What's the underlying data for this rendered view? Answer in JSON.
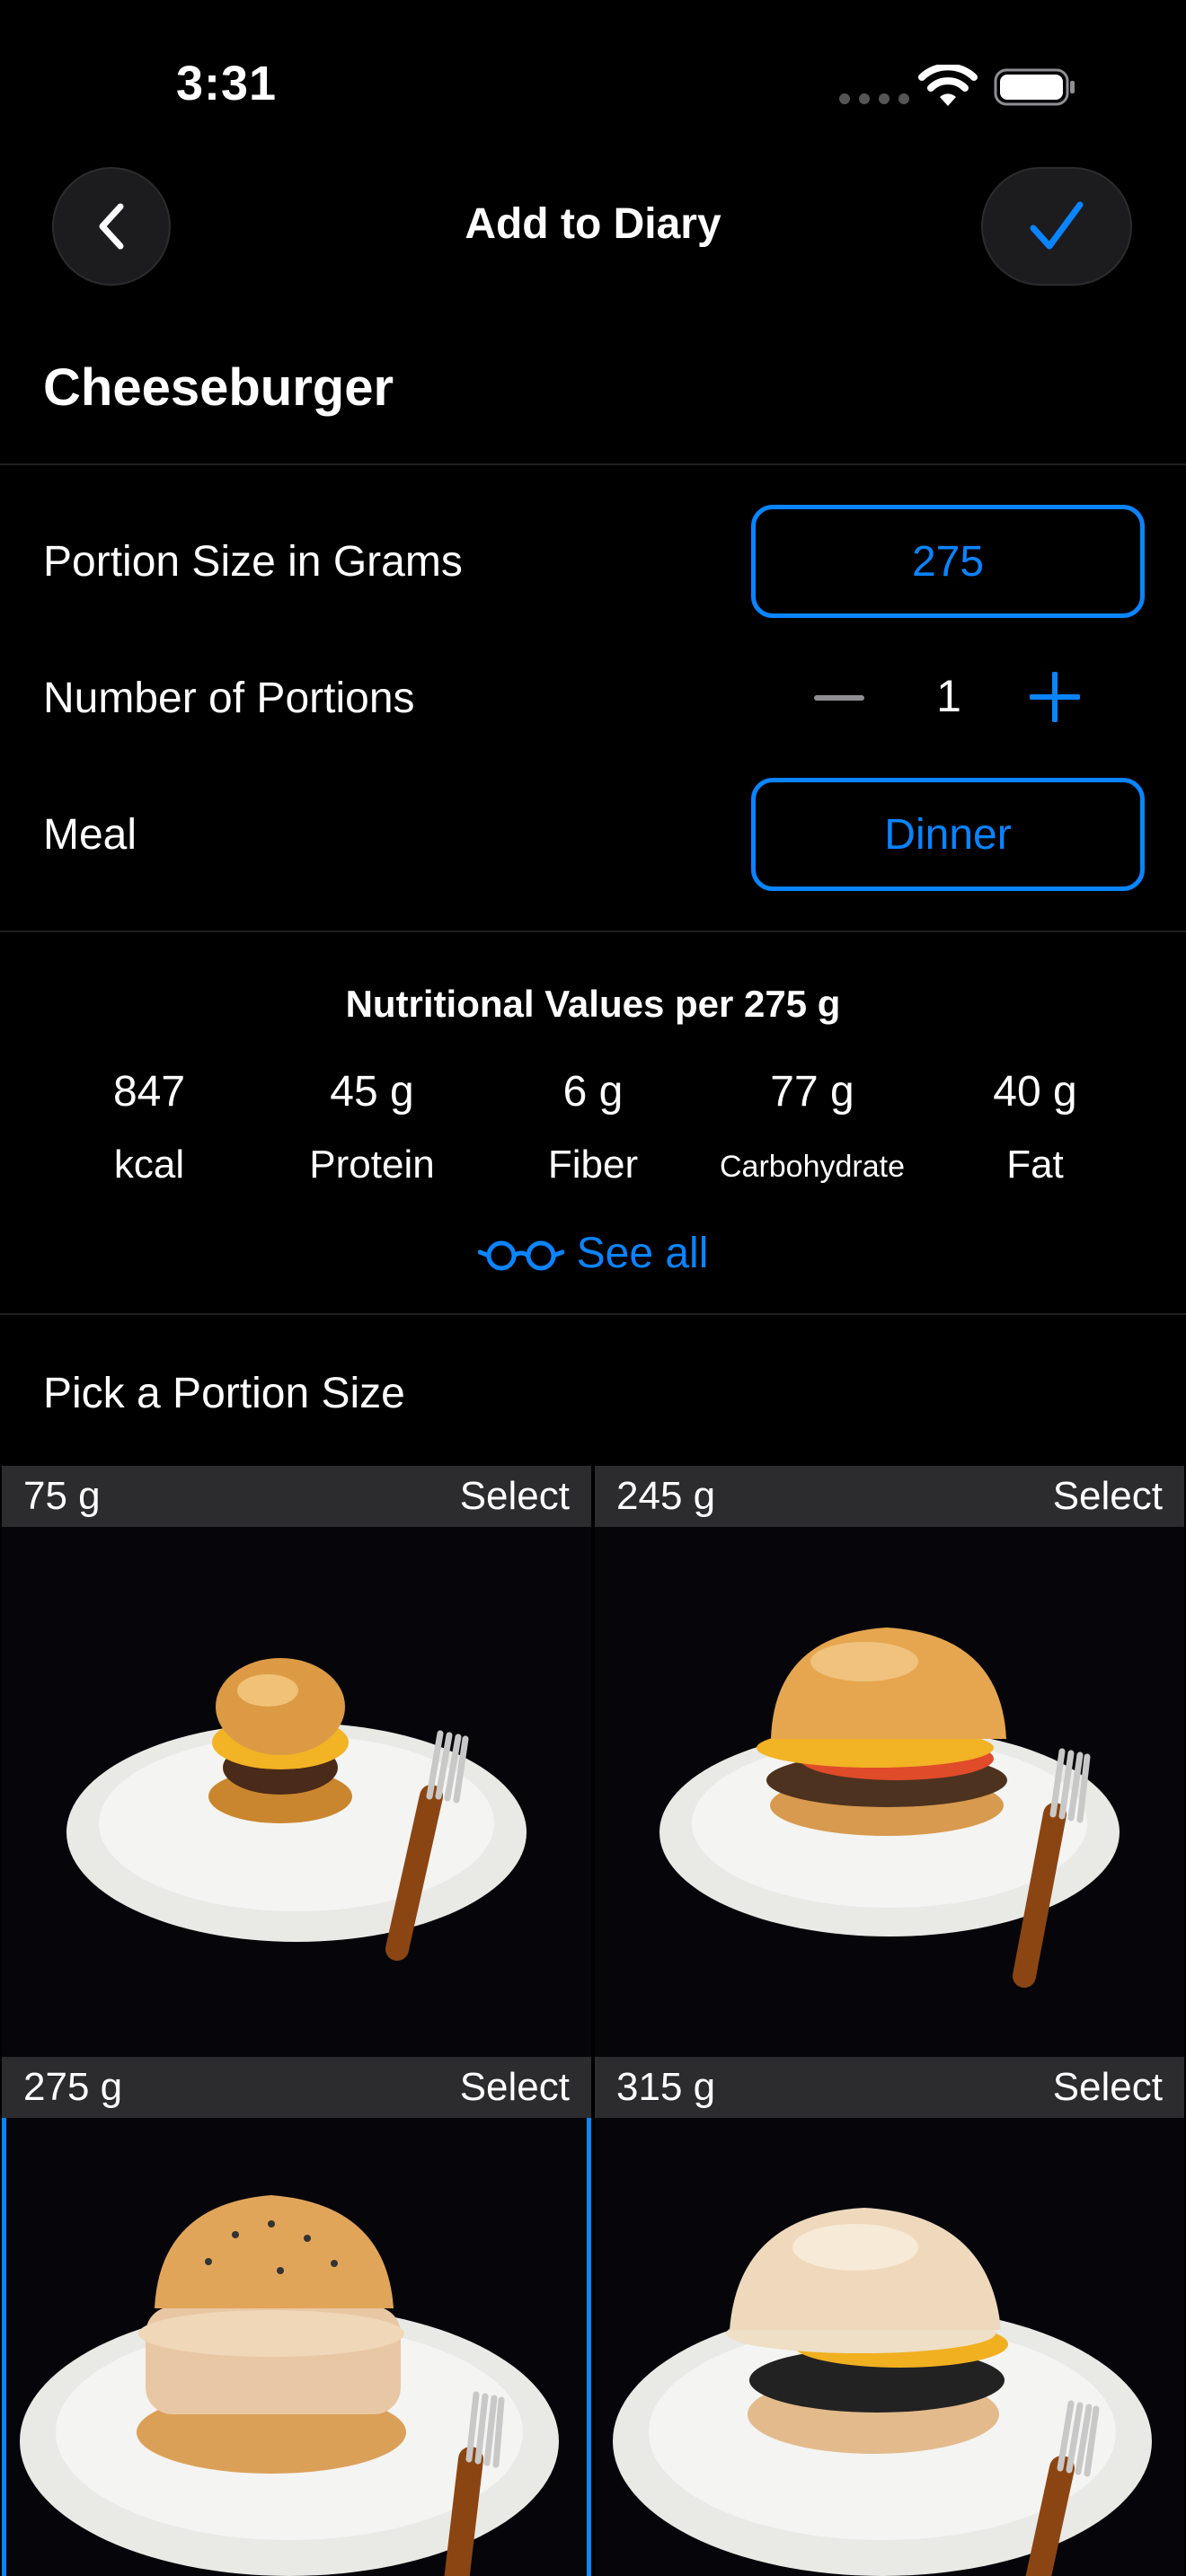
{
  "status_bar": {
    "time": "3:31"
  },
  "nav": {
    "title": "Add to Diary",
    "back_icon": "chevron-left-icon",
    "done_icon": "checkmark-icon"
  },
  "food": {
    "name": "Cheeseburger"
  },
  "form": {
    "portion_size_label": "Portion Size in Grams",
    "portion_size_value": "275",
    "portions_label": "Number of Portions",
    "portions_value": "1",
    "meal_label": "Meal",
    "meal_value": "Dinner"
  },
  "nutrition": {
    "title": "Nutritional Values per 275 g",
    "items": [
      {
        "value": "847",
        "label": "kcal"
      },
      {
        "value": "45 g",
        "label": "Protein"
      },
      {
        "value": "6 g",
        "label": "Fiber"
      },
      {
        "value": "77 g",
        "label": "Carbohydrate"
      },
      {
        "value": "40 g",
        "label": "Fat"
      }
    ],
    "see_all": "See all"
  },
  "portions": {
    "title": "Pick a Portion Size",
    "select_label": "Select",
    "options": [
      {
        "grams": "75 g",
        "selected": false
      },
      {
        "grams": "245 g",
        "selected": false
      },
      {
        "grams": "275 g",
        "selected": true
      },
      {
        "grams": "315 g",
        "selected": false
      }
    ]
  },
  "colors": {
    "accent": "#0a84ff",
    "background": "#000000",
    "cell_header": "#2c2c2e"
  }
}
